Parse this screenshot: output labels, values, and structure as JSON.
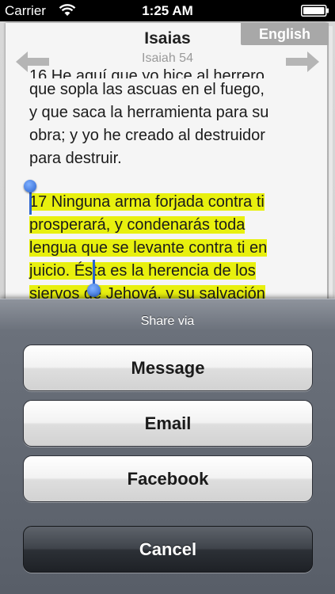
{
  "status_bar": {
    "carrier": "Carrier",
    "time": "1:25 AM",
    "wifi_icon": "wifi-icon",
    "battery_icon": "battery-icon"
  },
  "reader": {
    "language": "English",
    "book": "Isaias",
    "chapter_ref": "Isaiah 54",
    "prev_verse_lines": [
      "16 He aquí que yo hice al herrero",
      "que sopla las ascuas en el fuego,",
      "y que saca la herramienta para su",
      "obra; y yo he creado al destruidor",
      "para destruir."
    ],
    "selected_verse_lines": [
      "17 Ninguna arma forjada contra ti",
      "prosperará, y condenarás toda",
      "lengua que se levante contra ti en",
      "juicio. Ésta es la herencia de los",
      "siervos de Jehová, y su salvación"
    ],
    "colors": {
      "highlight": "#e8f00e",
      "selection": "#cfd8ee",
      "handle": "#2a63cf"
    }
  },
  "share_sheet": {
    "title": "Share via",
    "buttons": {
      "message": "Message",
      "email": "Email",
      "facebook": "Facebook",
      "cancel": "Cancel"
    }
  }
}
